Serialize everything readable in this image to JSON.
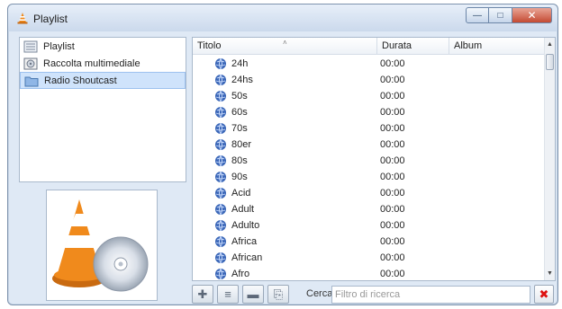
{
  "window": {
    "title": "Playlist",
    "minimize_label": "—",
    "maximize_label": "□",
    "close_label": "✕"
  },
  "sidebar": {
    "items": [
      {
        "label": "Playlist",
        "icon": "playlist-icon",
        "selected": false
      },
      {
        "label": "Raccolta multimediale",
        "icon": "media-library-icon",
        "selected": false
      },
      {
        "label": "Radio Shoutcast",
        "icon": "radio-folder-icon",
        "selected": true
      }
    ]
  },
  "table": {
    "columns": [
      "Titolo",
      "Durata",
      "Album"
    ],
    "sort_indicator": "˄",
    "rows": [
      {
        "title": "24h",
        "duration": "00:00"
      },
      {
        "title": "24hs",
        "duration": "00:00"
      },
      {
        "title": "50s",
        "duration": "00:00"
      },
      {
        "title": "60s",
        "duration": "00:00"
      },
      {
        "title": "70s",
        "duration": "00:00"
      },
      {
        "title": "80er",
        "duration": "00:00"
      },
      {
        "title": "80s",
        "duration": "00:00"
      },
      {
        "title": "90s",
        "duration": "00:00"
      },
      {
        "title": "Acid",
        "duration": "00:00"
      },
      {
        "title": "Adult",
        "duration": "00:00"
      },
      {
        "title": "Adulto",
        "duration": "00:00"
      },
      {
        "title": "Africa",
        "duration": "00:00"
      },
      {
        "title": "African",
        "duration": "00:00"
      },
      {
        "title": "Afro",
        "duration": "00:00"
      }
    ]
  },
  "scrollbar": {
    "up": "▲",
    "down": "▼"
  },
  "toolbar": {
    "add_glyph": "✚",
    "list_glyph": "≡",
    "remove_glyph": "▬",
    "doc_glyph": "⎘",
    "search_label": "Cerca",
    "search_placeholder": "Filtro di ricerca",
    "search_value": "",
    "clear_glyph": "✖"
  },
  "colors": {
    "selection": "#cfe3fb",
    "vlc_orange": "#f08a1c",
    "clear_red": "#dd1111"
  }
}
